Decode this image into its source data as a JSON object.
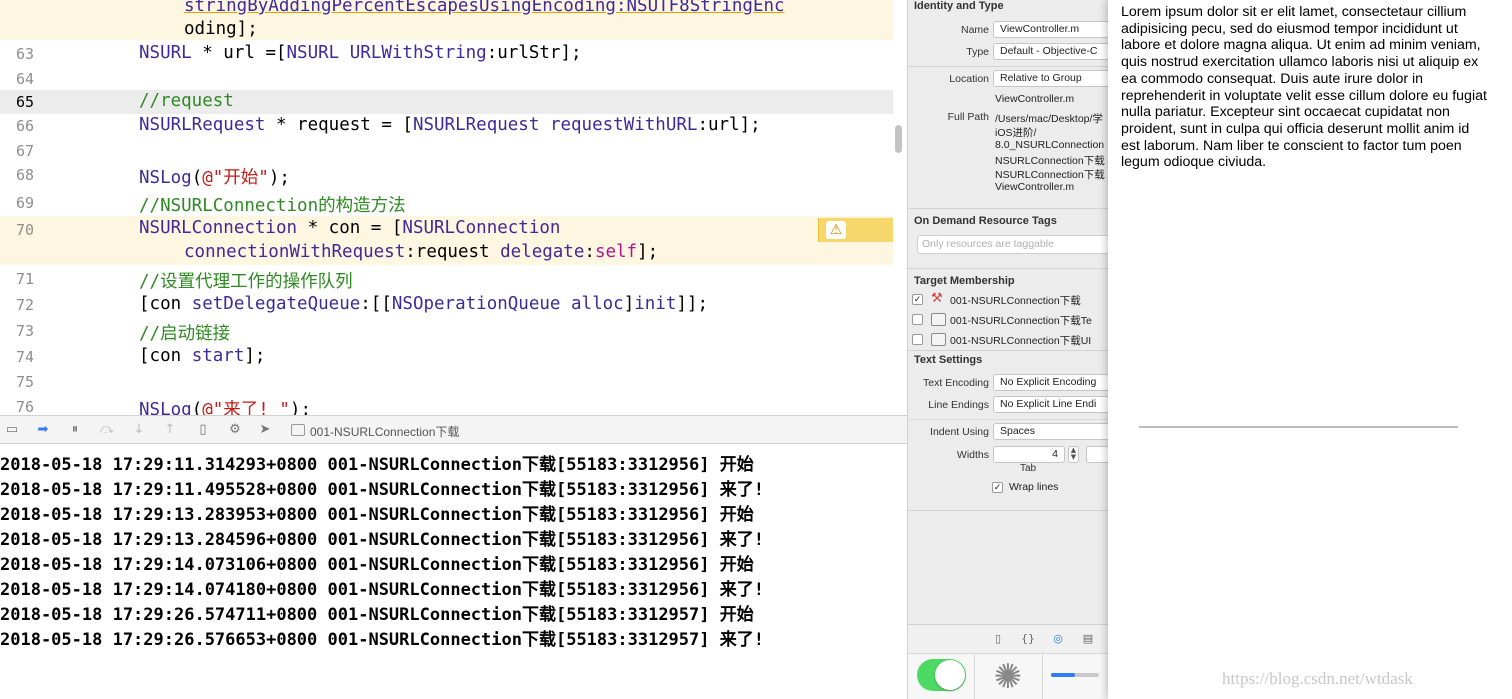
{
  "editor": {
    "top_text_1": "stringByAddingPercentEscapesUsingEncoding:NSUTF8StringEnc",
    "top_text_2": "oding];",
    "lines": [
      {
        "num": "63",
        "text": "NSURL * url =[NSURL URLWithString:urlStr];"
      },
      {
        "num": "64",
        "text": ""
      },
      {
        "num": "65",
        "text": "//request"
      },
      {
        "num": "66",
        "text": "NSURLRequest * request = [NSURLRequest requestWithURL:url];"
      },
      {
        "num": "67",
        "text": ""
      },
      {
        "num": "68",
        "text": "NSLog(@\"开始\");"
      },
      {
        "num": "69",
        "text": "//NSURLConnection的构造方法"
      },
      {
        "num": "70",
        "text": "NSURLConnection * con = [NSURLConnection",
        "cont": "connectionWithRequest:request delegate:self];"
      },
      {
        "num": "71",
        "text": "//设置代理工作的操作队列"
      },
      {
        "num": "72",
        "text": "[con setDelegateQueue:[[NSOperationQueue alloc]init]];"
      },
      {
        "num": "73",
        "text": "//启动链接"
      },
      {
        "num": "74",
        "text": "[con start];"
      },
      {
        "num": "75",
        "text": ""
      },
      {
        "num": "76",
        "text": "NSLog(@\"来了! \");"
      }
    ],
    "warning_icon": "warning-triangle-icon"
  },
  "debugbar": {
    "target": "001-NSURLConnection下载"
  },
  "console": {
    "lines": [
      "2018-05-18 17:29:11.314293+0800 001-NSURLConnection下载[55183:3312956] 开始",
      "2018-05-18 17:29:11.495528+0800 001-NSURLConnection下载[55183:3312956] 来了!",
      "2018-05-18 17:29:13.283953+0800 001-NSURLConnection下载[55183:3312956] 开始",
      "2018-05-18 17:29:13.284596+0800 001-NSURLConnection下载[55183:3312956] 来了!",
      "2018-05-18 17:29:14.073106+0800 001-NSURLConnection下载[55183:3312956] 开始",
      "2018-05-18 17:29:14.074180+0800 001-NSURLConnection下载[55183:3312956] 来了!",
      "2018-05-18 17:29:26.574711+0800 001-NSURLConnection下载[55183:3312957] 开始",
      "2018-05-18 17:29:26.576653+0800 001-NSURLConnection下载[55183:3312957] 来了!"
    ]
  },
  "inspector": {
    "identity": {
      "title": "Identity and Type",
      "name_label": "Name",
      "name_value": "ViewController.m",
      "type_label": "Type",
      "type_value": "Default - Objective-C",
      "location_label": "Location",
      "location_value": "Relative to Group",
      "location_file": "ViewController.m",
      "fullpath_label": "Full Path",
      "fullpath_lines": [
        "/Users/mac/Desktop/学",
        "iOS进阶/",
        "8.0_NSURLConnection",
        "NSURLConnection下载",
        "NSURLConnection下载",
        "ViewController.m"
      ]
    },
    "on_demand": {
      "title": "On Demand Resource Tags",
      "placeholder": "Only resources are taggable"
    },
    "target_membership": {
      "title": "Target Membership",
      "items": [
        {
          "label": "001-NSURLConnection下载",
          "checked": true
        },
        {
          "label": "001-NSURLConnection下载Te",
          "checked": false
        },
        {
          "label": "001-NSURLConnection下载UI",
          "checked": false
        }
      ]
    },
    "text_settings": {
      "title": "Text Settings",
      "encoding_label": "Text Encoding",
      "encoding_value": "No Explicit Encoding",
      "endings_label": "Line Endings",
      "endings_value": "No Explicit Line Endi",
      "indent_label": "Indent Using",
      "indent_value": "Spaces",
      "widths_label": "Widths",
      "tab_value": "4",
      "tab_label": "Tab",
      "wrap_label": "Wrap lines",
      "wrap_checked": true
    },
    "checkmark": "✓"
  },
  "right_panel": {
    "lorem": "Lorem ipsum dolor sit er elit lamet, consectetaur cillium adipisicing pecu, sed do eiusmod tempor incididunt ut labore et dolore magna aliqua. Ut enim ad minim veniam, quis nostrud exercitation ullamco laboris nisi ut aliquip ex ea commodo consequat. Duis aute irure dolor in reprehenderit in voluptate velit esse cillum dolore eu fugiat nulla pariatur. Excepteur sint occaecat cupidatat non proident, sunt in culpa qui officia deserunt mollit anim id est laborum. Nam liber te conscient to factor tum poen legum odioque civiuda.",
    "watermark": "https://blog.csdn.net/wtdask"
  },
  "colors": {
    "keyword": "#3f2a99",
    "comment": "#2f8a23",
    "string": "#c41a16",
    "self": "#b3148f",
    "warning_bg": "#fdf6e0",
    "current_line": "#ececec",
    "switch_on": "#4cd964"
  }
}
